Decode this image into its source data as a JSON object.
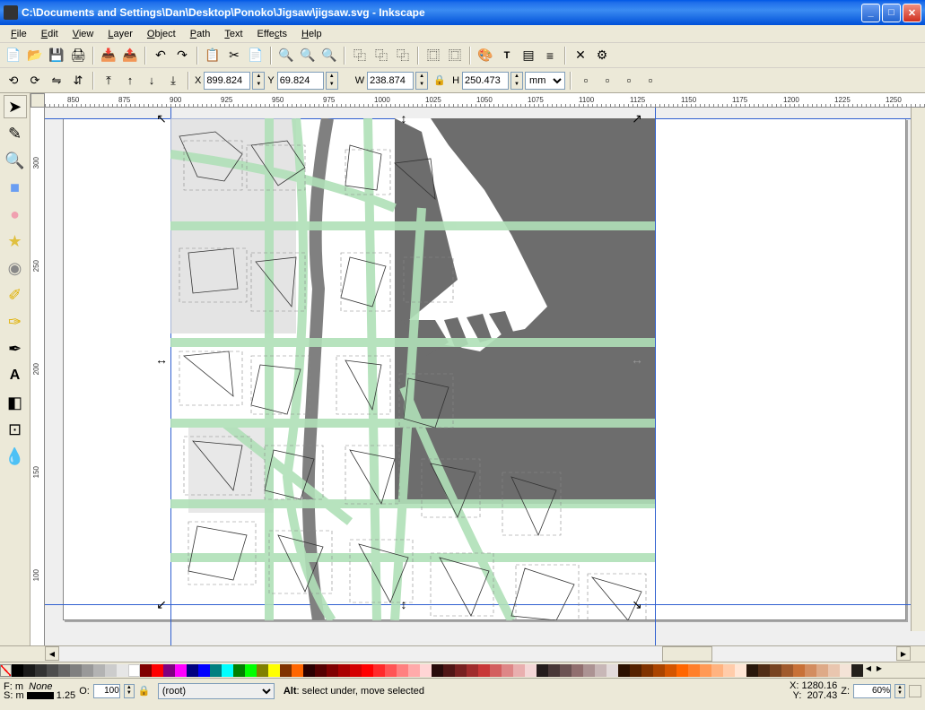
{
  "window": {
    "title": "C:\\Documents and Settings\\Dan\\Desktop\\Ponoko\\Jigsaw\\jigsaw.svg - Inkscape"
  },
  "menu": {
    "file": "File",
    "edit": "Edit",
    "view": "View",
    "layer": "Layer",
    "object": "Object",
    "path": "Path",
    "text": "Text",
    "effects": "Effects",
    "help": "Help"
  },
  "toolbar2": {
    "x_label": "X",
    "x_value": "899.824",
    "y_label": "Y",
    "y_value": "69.824",
    "w_label": "W",
    "w_value": "238.874",
    "h_label": "H",
    "h_value": "250.473",
    "unit": "mm"
  },
  "ruler_h": [
    "850",
    "875",
    "900",
    "925",
    "950",
    "975",
    "1000",
    "1025",
    "1050",
    "1075",
    "1100",
    "1125",
    "1150",
    "1175",
    "1200",
    "1225",
    "1250"
  ],
  "ruler_v": [
    "300",
    "250",
    "200",
    "150",
    "100"
  ],
  "status": {
    "fill_label": "F:",
    "stroke_label": "S:",
    "fill_value": "m",
    "stroke_value": "m",
    "none": "None",
    "stroke_w": "1.25",
    "opacity_label": "O:",
    "opacity_value": "100",
    "layer": "(root)",
    "hint": "Alt: select under, move selected",
    "hint_bold": "Alt",
    "cursor_x_label": "X:",
    "cursor_y_label": "Y:",
    "cursor_x": "1280.16",
    "cursor_y": "207.43",
    "zoom_label": "Z:",
    "zoom": "60%"
  }
}
